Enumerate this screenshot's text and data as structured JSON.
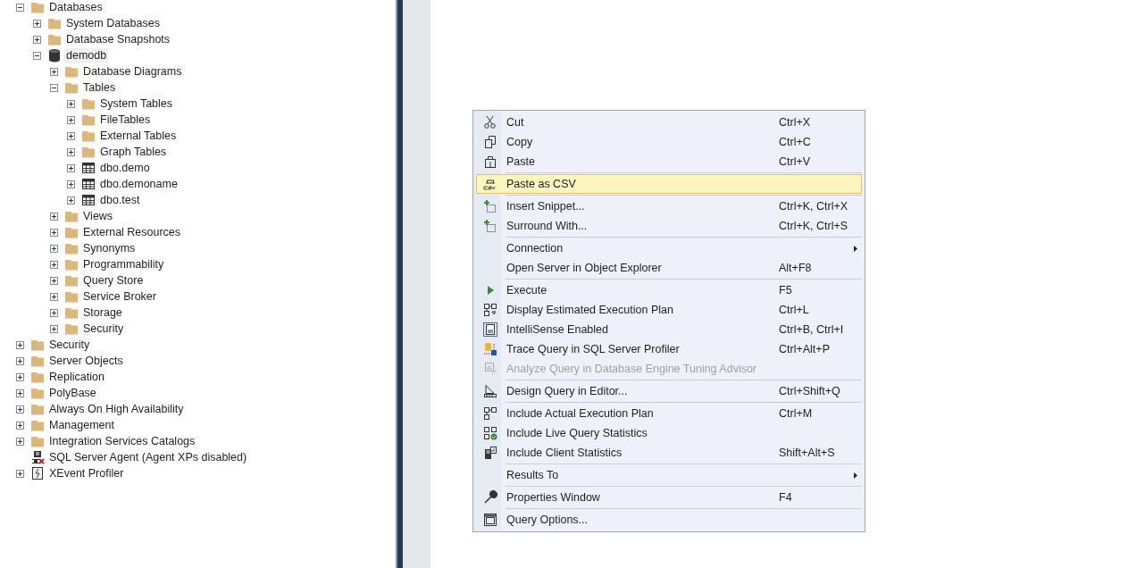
{
  "tree": [
    {
      "label": "Databases",
      "kind": "folder",
      "expanded": true,
      "selected": false,
      "children": [
        {
          "label": "System Databases",
          "kind": "folder",
          "expanded": false,
          "selected": false
        },
        {
          "label": "Database Snapshots",
          "kind": "folder",
          "expanded": false,
          "selected": false
        },
        {
          "label": "demodb",
          "kind": "database",
          "expanded": true,
          "selected": true,
          "children": [
            {
              "label": "Database Diagrams",
              "kind": "folder",
              "expanded": false,
              "selected": false
            },
            {
              "label": "Tables",
              "kind": "folder",
              "expanded": true,
              "selected": false,
              "children": [
                {
                  "label": "System Tables",
                  "kind": "folder",
                  "expanded": false,
                  "selected": false
                },
                {
                  "label": "FileTables",
                  "kind": "folder",
                  "expanded": false,
                  "selected": false
                },
                {
                  "label": "External Tables",
                  "kind": "folder",
                  "expanded": false,
                  "selected": false
                },
                {
                  "label": "Graph Tables",
                  "kind": "folder",
                  "expanded": false,
                  "selected": false
                },
                {
                  "label": "dbo.demo",
                  "kind": "table",
                  "expanded": false,
                  "selected": false
                },
                {
                  "label": "dbo.demoname",
                  "kind": "table",
                  "expanded": false,
                  "selected": false
                },
                {
                  "label": "dbo.test",
                  "kind": "table",
                  "expanded": false,
                  "selected": false
                }
              ]
            },
            {
              "label": "Views",
              "kind": "folder",
              "expanded": false,
              "selected": false
            },
            {
              "label": "External Resources",
              "kind": "folder",
              "expanded": false,
              "selected": false
            },
            {
              "label": "Synonyms",
              "kind": "folder",
              "expanded": false,
              "selected": false
            },
            {
              "label": "Programmability",
              "kind": "folder",
              "expanded": false,
              "selected": false
            },
            {
              "label": "Query Store",
              "kind": "folder",
              "expanded": false,
              "selected": false
            },
            {
              "label": "Service Broker",
              "kind": "folder",
              "expanded": false,
              "selected": false
            },
            {
              "label": "Storage",
              "kind": "folder",
              "expanded": false,
              "selected": false
            },
            {
              "label": "Security",
              "kind": "folder",
              "expanded": false,
              "selected": false
            }
          ]
        }
      ]
    },
    {
      "label": "Security",
      "kind": "folder",
      "expanded": false,
      "selected": false
    },
    {
      "label": "Server Objects",
      "kind": "folder",
      "expanded": false,
      "selected": false
    },
    {
      "label": "Replication",
      "kind": "folder",
      "expanded": false,
      "selected": false
    },
    {
      "label": "PolyBase",
      "kind": "folder",
      "expanded": false,
      "selected": false
    },
    {
      "label": "Always On High Availability",
      "kind": "folder",
      "expanded": false,
      "selected": false
    },
    {
      "label": "Management",
      "kind": "folder",
      "expanded": false,
      "selected": false
    },
    {
      "label": "Integration Services Catalogs",
      "kind": "folder",
      "expanded": false,
      "selected": false
    },
    {
      "label": "SQL Server Agent (Agent XPs disabled)",
      "kind": "agent",
      "selected": false
    },
    {
      "label": "XEvent Profiler",
      "kind": "profiler",
      "expanded": false,
      "selected": false
    }
  ],
  "context_menu": [
    {
      "kind": "item",
      "label": "Cut",
      "shortcut": "Ctrl+X",
      "selected": false,
      "disabled": false
    },
    {
      "kind": "item",
      "label": "Copy",
      "shortcut": "Ctrl+C",
      "selected": false,
      "disabled": false
    },
    {
      "kind": "item",
      "label": "Paste",
      "shortcut": "Ctrl+V",
      "selected": false,
      "disabled": false
    },
    {
      "kind": "separator"
    },
    {
      "kind": "item",
      "label": "Paste as CSV",
      "selected": true,
      "disabled": false
    },
    {
      "kind": "separator"
    },
    {
      "kind": "item",
      "label": "Insert Snippet...",
      "shortcut": "Ctrl+K, Ctrl+X",
      "selected": false,
      "disabled": false
    },
    {
      "kind": "item",
      "label": "Surround With...",
      "shortcut": "Ctrl+K, Ctrl+S",
      "selected": false,
      "disabled": false
    },
    {
      "kind": "separator"
    },
    {
      "kind": "submenu",
      "label": "Connection",
      "selected": false,
      "disabled": false
    },
    {
      "kind": "item",
      "label": "Open Server in Object Explorer",
      "shortcut": "Alt+F8",
      "selected": false,
      "disabled": false
    },
    {
      "kind": "separator"
    },
    {
      "kind": "item",
      "label": "Execute",
      "shortcut": "F5",
      "selected": false,
      "disabled": false
    },
    {
      "kind": "item",
      "label": "Display Estimated Execution Plan",
      "shortcut": "Ctrl+L",
      "selected": false,
      "disabled": false
    },
    {
      "kind": "item",
      "label": "IntelliSense Enabled",
      "shortcut": "Ctrl+B, Ctrl+I",
      "selected": false,
      "disabled": false,
      "checked": true
    },
    {
      "kind": "item",
      "label": "Trace Query in SQL Server Profiler",
      "shortcut": "Ctrl+Alt+P",
      "selected": false,
      "disabled": false
    },
    {
      "kind": "item",
      "label": "Analyze Query in Database Engine Tuning Advisor",
      "selected": false,
      "disabled": true
    },
    {
      "kind": "separator"
    },
    {
      "kind": "item",
      "label": "Design Query in Editor...",
      "shortcut": "Ctrl+Shift+Q",
      "selected": false,
      "disabled": false
    },
    {
      "kind": "separator"
    },
    {
      "kind": "item",
      "label": "Include Actual Execution Plan",
      "shortcut": "Ctrl+M",
      "selected": false,
      "disabled": false
    },
    {
      "kind": "item",
      "label": "Include Live Query Statistics",
      "selected": false,
      "disabled": false
    },
    {
      "kind": "item",
      "label": "Include Client Statistics",
      "shortcut": "Shift+Alt+S",
      "selected": false,
      "disabled": false
    },
    {
      "kind": "separator"
    },
    {
      "kind": "submenu",
      "label": "Results To",
      "selected": false,
      "disabled": false
    },
    {
      "kind": "separator"
    },
    {
      "kind": "item",
      "label": "Properties Window",
      "shortcut": "F4",
      "selected": false,
      "disabled": false
    },
    {
      "kind": "separator"
    },
    {
      "kind": "item",
      "label": "Query Options...",
      "selected": false,
      "disabled": false
    }
  ]
}
